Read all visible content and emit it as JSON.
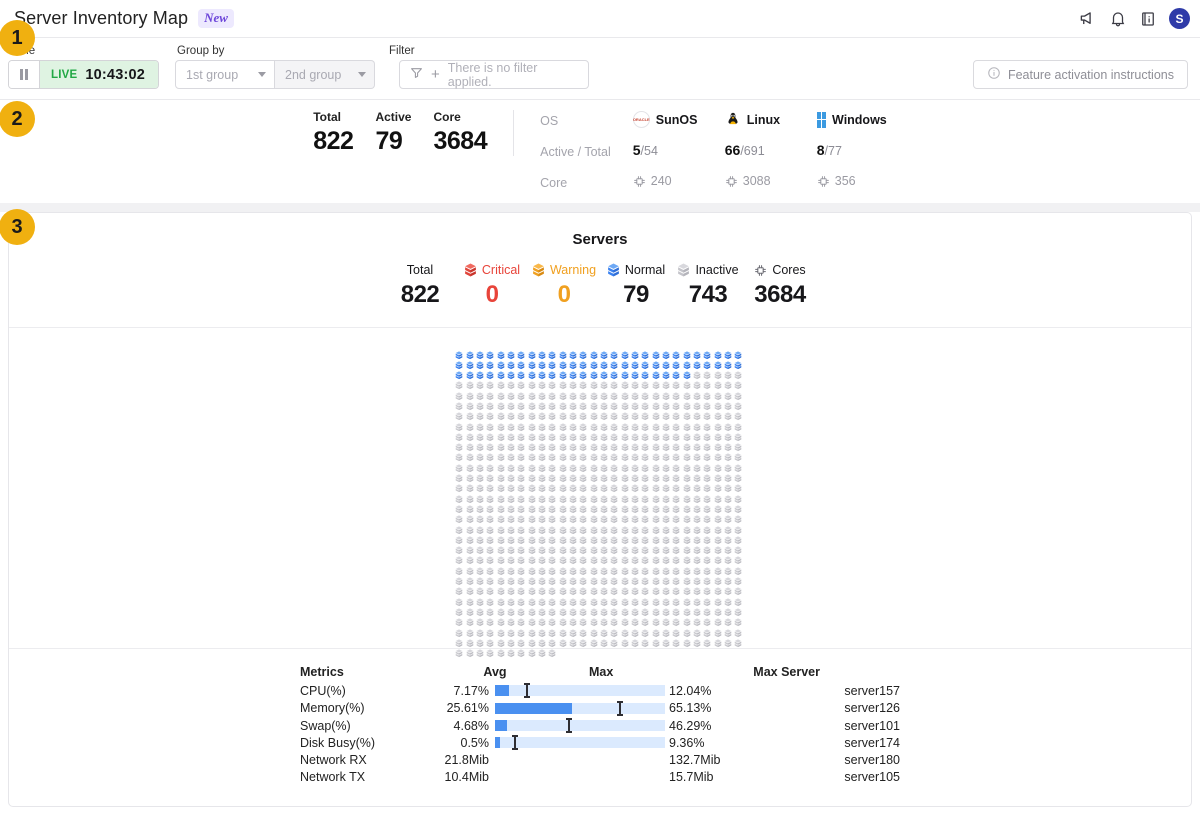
{
  "header": {
    "title": "Server Inventory Map",
    "badge": "New",
    "icons": [
      {
        "name": "megaphone-icon"
      },
      {
        "name": "bell-icon"
      },
      {
        "name": "info-book-icon"
      }
    ],
    "avatar_initial": "S",
    "avatar_color": "#2f3ba8"
  },
  "toolbar": {
    "time_label": "Time",
    "pause_name": "pause-button",
    "live_tag": "LIVE",
    "live_time": "10:43:02",
    "live_bg": "#dff3e2",
    "live_color": "#22a845",
    "groupby_label": "Group by",
    "group1_placeholder": "1st group",
    "group2_placeholder": "2nd group",
    "filter_label": "Filter",
    "filter_placeholder": "There is no filter applied.",
    "feature_button": "Feature activation instructions"
  },
  "os_summary": {
    "totals": [
      {
        "label": "Total",
        "value": "822"
      },
      {
        "label": "Active",
        "value": "79"
      },
      {
        "label": "Core",
        "value": "3684"
      }
    ],
    "row_labels": [
      "OS",
      "Active / Total",
      "Core"
    ],
    "os": [
      {
        "name": "SunOS",
        "icon": "oracle-icon",
        "active": "5",
        "total": "/54",
        "core": "240"
      },
      {
        "name": "Linux",
        "icon": "tux-icon",
        "active": "66",
        "total": "/691",
        "core": "3088"
      },
      {
        "name": "Windows",
        "icon": "windows-icon",
        "active": "8",
        "total": "/77",
        "core": "356"
      }
    ]
  },
  "servers": {
    "title": "Servers",
    "stats": [
      {
        "label": "Total",
        "value": "822",
        "color": "#17171a",
        "icon": null
      },
      {
        "label": "Critical",
        "value": "0",
        "color": "#e8443a",
        "icon": "cube-critical-icon"
      },
      {
        "label": "Warning",
        "value": "0",
        "color": "#f0a020",
        "icon": "cube-warning-icon"
      },
      {
        "label": "Normal",
        "value": "79",
        "color": "#17171a",
        "icon": "cube-normal-icon"
      },
      {
        "label": "Inactive",
        "value": "743",
        "color": "#17171a",
        "icon": "cube-inactive-icon"
      },
      {
        "label": "Cores",
        "value": "3684",
        "color": "#17171a",
        "icon": "cpu-icon"
      }
    ],
    "grid": {
      "columns": 28,
      "total": 822,
      "normal": 79,
      "normal_color": "#4a90f0",
      "inactive_color": "#c9c9ce"
    }
  },
  "metrics": {
    "headers": [
      "Metrics",
      "Avg",
      "Max",
      "Max Server"
    ],
    "rows": [
      {
        "name": "CPU(%)",
        "avg": "7.17%",
        "max": "12.04%",
        "server": "server157",
        "fill_pct": 8,
        "mark_pct": 18
      },
      {
        "name": "Memory(%)",
        "avg": "25.61%",
        "max": "65.13%",
        "server": "server126",
        "fill_pct": 45,
        "mark_pct": 73
      },
      {
        "name": "Swap(%)",
        "avg": "4.68%",
        "max": "46.29%",
        "server": "server101",
        "fill_pct": 7,
        "mark_pct": 43
      },
      {
        "name": "Disk Busy(%)",
        "avg": "0.5%",
        "max": "9.36%",
        "server": "server174",
        "fill_pct": 3,
        "mark_pct": 11
      },
      {
        "name": "Network RX",
        "avg": "21.8Mib",
        "max": "132.7Mib",
        "server": "server180",
        "fill_pct": null,
        "mark_pct": null
      },
      {
        "name": "Network TX",
        "avg": "10.4Mib",
        "max": "15.7Mib",
        "server": "server105",
        "fill_pct": null,
        "mark_pct": null
      }
    ]
  },
  "markers": [
    {
      "id": "m1",
      "label": "1"
    },
    {
      "id": "m2",
      "label": "2"
    },
    {
      "id": "m3",
      "label": "3"
    }
  ]
}
